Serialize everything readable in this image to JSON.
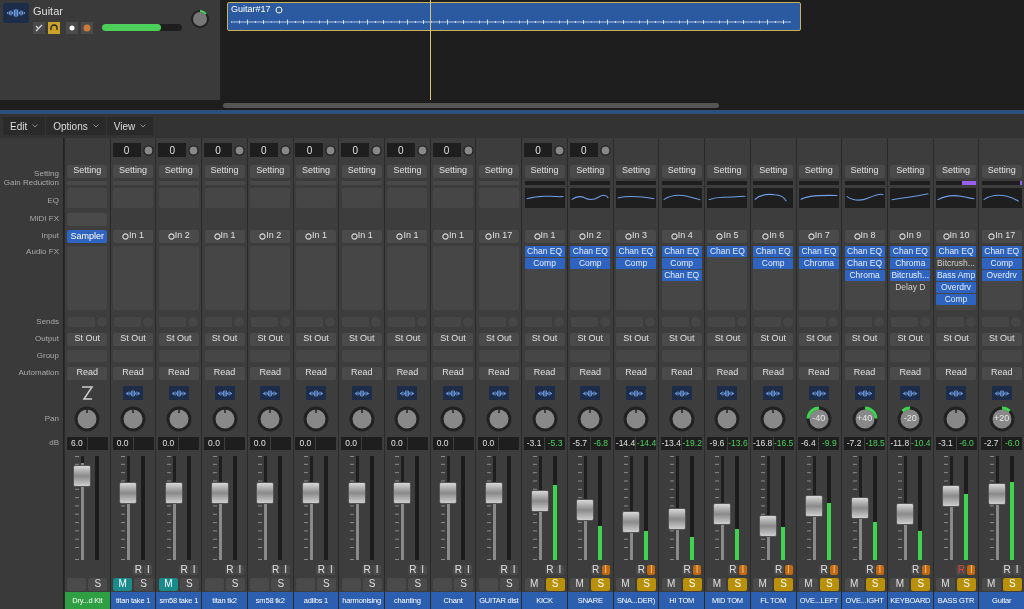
{
  "track": {
    "name": "Guitar",
    "headphones_on": true,
    "volume": {
      "level": 0.74
    },
    "region": {
      "title": "Guitar#17"
    }
  },
  "menu": [
    "Edit",
    "Options",
    "View"
  ],
  "row_labels": {
    "setting": "Setting",
    "gain_reduction": "Gain Reduction",
    "eq": "EQ",
    "midi_fx": "MIDI FX",
    "input": "Input",
    "audio_fx": "Audio FX",
    "sends": "Sends",
    "output": "Output",
    "group": "Group",
    "automation": "Automation",
    "pan": "Pan",
    "db": "dB"
  },
  "channels": [
    {
      "name": "Dry...d Kit",
      "kind": "instrument",
      "setting": "Setting",
      "input": "Sampler",
      "output": "St Out",
      "automation": "Read",
      "volume": "6.0",
      "fader": {
        "level": 0.93
      },
      "mute": {
        "on": false
      },
      "solo": {
        "label": "S",
        "on": false
      }
    },
    {
      "name": "titan take 1",
      "kind": "audio",
      "gain": "0",
      "setting": "Setting",
      "input": "In 1",
      "output": "St Out",
      "automation": "Read",
      "volume": "0.0",
      "fader": {
        "level": 0.72
      },
      "record": {
        "label": "R",
        "on": false
      },
      "monitor": {
        "label": "I",
        "on": false
      },
      "mute": {
        "label": "M",
        "on": true
      },
      "solo": {
        "label": "S",
        "on": false
      }
    },
    {
      "name": "sm58 take 1",
      "kind": "audio",
      "gain": "0",
      "setting": "Setting",
      "input": "In 2",
      "output": "St Out",
      "automation": "Read",
      "volume": "0.0",
      "fader": {
        "level": 0.72
      },
      "record": {
        "label": "R",
        "on": false
      },
      "monitor": {
        "label": "I",
        "on": false
      },
      "mute": {
        "label": "M",
        "on": true
      },
      "solo": {
        "label": "S",
        "on": false
      }
    },
    {
      "name": "titan tk2",
      "kind": "audio",
      "gain": "0",
      "setting": "Setting",
      "input": "In 1",
      "output": "St Out",
      "automation": "Read",
      "volume": "0.0",
      "fader": {
        "level": 0.72
      },
      "record": {
        "label": "R",
        "on": false
      },
      "monitor": {
        "label": "I",
        "on": false
      },
      "mute": {
        "on": false
      },
      "solo": {
        "label": "S",
        "on": false
      }
    },
    {
      "name": "sm58 tk2",
      "kind": "audio",
      "gain": "0",
      "setting": "Setting",
      "input": "In 2",
      "output": "St Out",
      "automation": "Read",
      "volume": "0.0",
      "fader": {
        "level": 0.72
      },
      "record": {
        "label": "R",
        "on": false
      },
      "monitor": {
        "label": "I",
        "on": false
      },
      "mute": {
        "on": false
      },
      "solo": {
        "label": "S",
        "on": false
      }
    },
    {
      "name": "adlibs 1",
      "kind": "audio",
      "gain": "0",
      "setting": "Setting",
      "input": "In 1",
      "output": "St Out",
      "automation": "Read",
      "volume": "0.0",
      "fader": {
        "level": 0.72
      },
      "record": {
        "label": "R",
        "on": false
      },
      "monitor": {
        "label": "I",
        "on": false
      },
      "mute": {
        "on": false
      },
      "solo": {
        "label": "S",
        "on": false
      }
    },
    {
      "name": "harmonising",
      "kind": "audio",
      "gain": "0",
      "setting": "Setting",
      "input": "In 1",
      "output": "St Out",
      "automation": "Read",
      "volume": "0.0",
      "fader": {
        "level": 0.72
      },
      "record": {
        "label": "R",
        "on": false
      },
      "monitor": {
        "label": "I",
        "on": false
      },
      "mute": {
        "on": false
      },
      "solo": {
        "label": "S",
        "on": false
      }
    },
    {
      "name": "chanting",
      "kind": "audio",
      "gain": "0",
      "setting": "Setting",
      "input": "In 1",
      "output": "St Out",
      "automation": "Read",
      "volume": "0.0",
      "fader": {
        "level": 0.72
      },
      "record": {
        "label": "R",
        "on": false
      },
      "monitor": {
        "label": "I",
        "on": false
      },
      "mute": {
        "on": false
      },
      "solo": {
        "label": "S",
        "on": false
      }
    },
    {
      "name": "Chant",
      "kind": "audio",
      "gain": "0",
      "setting": "Setting",
      "input": "In 1",
      "output": "St Out",
      "automation": "Read",
      "volume": "0.0",
      "fader": {
        "level": 0.72
      },
      "record": {
        "label": "R",
        "on": false
      },
      "monitor": {
        "label": "I",
        "on": false
      },
      "mute": {
        "on": false
      },
      "solo": {
        "label": "S",
        "on": false
      }
    },
    {
      "name": "GUITAR dist",
      "kind": "audio",
      "setting": "Setting",
      "input": "In 17",
      "output": "St Out",
      "automation": "Read",
      "volume": "0.0",
      "fader": {
        "level": 0.72
      },
      "record": {
        "label": "R",
        "on": false
      },
      "monitor": {
        "label": "I",
        "on": false
      },
      "mute": {
        "on": false
      },
      "solo": {
        "label": "S",
        "on": false
      }
    },
    {
      "name": "KICK",
      "kind": "audio",
      "gain": "0",
      "setting": "Setting",
      "eq": true,
      "input": "In 1",
      "audio_fx": [
        {
          "name": "Chan EQ",
          "active": true
        },
        {
          "name": "Comp",
          "active": true
        }
      ],
      "output": "St Out",
      "automation": "Read",
      "volume": "-3.1",
      "peak": "-5.3",
      "fader": {
        "level": 0.62
      },
      "meter": {
        "level": 0.72
      },
      "record": {
        "label": "R",
        "on": false
      },
      "monitor": {
        "label": "I",
        "on": false
      },
      "mute": {
        "label": "M",
        "on": false
      },
      "solo": {
        "label": "S",
        "on": true
      }
    },
    {
      "name": "SNARE",
      "kind": "audio",
      "gain": "0",
      "setting": "Setting",
      "eq": true,
      "input": "In 2",
      "audio_fx": [
        {
          "name": "Chan EQ",
          "active": true
        },
        {
          "name": "Comp",
          "active": true
        }
      ],
      "output": "St Out",
      "automation": "Read",
      "volume": "-5.7",
      "peak": "-6.8",
      "fader": {
        "level": 0.5
      },
      "meter": {
        "level": 0.33
      },
      "record": {
        "label": "R",
        "on": false
      },
      "monitor": {
        "label": "I",
        "on": true
      },
      "mute": {
        "label": "M",
        "on": false
      },
      "solo": {
        "label": "S",
        "on": true
      }
    },
    {
      "name": "SNA...DER)",
      "kind": "audio",
      "setting": "Setting",
      "eq": true,
      "input": "In 3",
      "audio_fx": [
        {
          "name": "Chan EQ",
          "active": true
        },
        {
          "name": "Comp",
          "active": true
        }
      ],
      "output": "St Out",
      "automation": "Read",
      "volume": "-14.4",
      "peak": "-14.4",
      "fader": {
        "level": 0.35
      },
      "meter": {
        "level": 0.28
      },
      "record": {
        "label": "R",
        "on": false
      },
      "monitor": {
        "label": "I",
        "on": true
      },
      "mute": {
        "label": "M",
        "on": false
      },
      "solo": {
        "label": "S",
        "on": true
      }
    },
    {
      "name": "HI TOM",
      "kind": "audio",
      "setting": "Setting",
      "eq": true,
      "input": "In 4",
      "audio_fx": [
        {
          "name": "Chan EQ",
          "active": true
        },
        {
          "name": "Comp",
          "active": true
        },
        {
          "name": "Chan EQ",
          "active": true
        }
      ],
      "output": "St Out",
      "automation": "Read",
      "volume": "-13.4",
      "peak": "-19.2",
      "fader": {
        "level": 0.38
      },
      "meter": {
        "level": 0.22
      },
      "record": {
        "label": "R",
        "on": false
      },
      "monitor": {
        "label": "I",
        "on": true
      },
      "mute": {
        "label": "M",
        "on": false
      },
      "solo": {
        "label": "S",
        "on": true
      }
    },
    {
      "name": "MID TOM",
      "kind": "audio",
      "setting": "Setting",
      "eq": true,
      "input": "In 5",
      "audio_fx": [
        {
          "name": "Chan EQ",
          "active": true
        }
      ],
      "output": "St Out",
      "automation": "Read",
      "volume": "-9.6",
      "peak": "-13.6",
      "fader": {
        "level": 0.45
      },
      "meter": {
        "level": 0.3
      },
      "record": {
        "label": "R",
        "on": false
      },
      "monitor": {
        "label": "I",
        "on": true
      },
      "mute": {
        "label": "M",
        "on": false
      },
      "solo": {
        "label": "S",
        "on": true
      }
    },
    {
      "name": "FL TOM",
      "kind": "audio",
      "setting": "Setting",
      "eq": true,
      "input": "In 6",
      "audio_fx": [
        {
          "name": "Chan EQ",
          "active": true
        },
        {
          "name": "Comp",
          "active": true
        }
      ],
      "output": "St Out",
      "automation": "Read",
      "volume": "-16.8",
      "peak": "-16.5",
      "fader": {
        "level": 0.3
      },
      "meter": {
        "level": 0.32
      },
      "record": {
        "label": "R",
        "on": false
      },
      "monitor": {
        "label": "I",
        "on": true
      },
      "mute": {
        "label": "M",
        "on": false
      },
      "solo": {
        "label": "S",
        "on": true
      }
    },
    {
      "name": "OVE...LEFT",
      "kind": "audio",
      "setting": "Setting",
      "eq": true,
      "input": "In 7",
      "audio_fx": [
        {
          "name": "Chan EQ",
          "active": true
        },
        {
          "name": "Chroma",
          "active": true
        }
      ],
      "output": "St Out",
      "automation": "Read",
      "pan": "-40",
      "volume": "-6.4",
      "peak": "-9.9",
      "fader": {
        "level": 0.55
      },
      "meter": {
        "level": 0.55
      },
      "record": {
        "label": "R",
        "on": false
      },
      "monitor": {
        "label": "I",
        "on": true
      },
      "mute": {
        "label": "M",
        "on": false
      },
      "solo": {
        "label": "S",
        "on": true
      }
    },
    {
      "name": "OVE...IGHT",
      "kind": "audio",
      "setting": "Setting",
      "eq": true,
      "input": "In 8",
      "audio_fx": [
        {
          "name": "Chan EQ",
          "active": true
        },
        {
          "name": "Chan EQ",
          "active": true
        },
        {
          "name": "Chroma",
          "active": true
        }
      ],
      "output": "St Out",
      "automation": "Read",
      "pan": "+40",
      "volume": "-7.2",
      "peak": "-18.5",
      "fader": {
        "level": 0.53
      },
      "meter": {
        "level": 0.37
      },
      "record": {
        "label": "R",
        "on": false
      },
      "monitor": {
        "label": "I",
        "on": true
      },
      "mute": {
        "label": "M",
        "on": false
      },
      "solo": {
        "label": "S",
        "on": true
      }
    },
    {
      "name": "KEYBOARD",
      "kind": "audio",
      "setting": "Setting",
      "eq": true,
      "input": "In 9",
      "audio_fx": [
        {
          "name": "Chan EQ",
          "active": true
        },
        {
          "name": "Chroma",
          "active": true
        },
        {
          "name": "Bitcrush...",
          "active": true
        },
        {
          "name": "Delay D",
          "active": false
        }
      ],
      "output": "St Out",
      "automation": "Read",
      "pan": "-20",
      "volume": "-11.8",
      "peak": "-10.4",
      "fader": {
        "level": 0.45
      },
      "meter": {
        "level": 0.28
      },
      "record": {
        "label": "R",
        "on": false
      },
      "monitor": {
        "label": "I",
        "on": true
      },
      "mute": {
        "label": "M",
        "on": false
      },
      "solo": {
        "label": "S",
        "on": true
      }
    },
    {
      "name": "BASS GTR",
      "kind": "audio",
      "setting": "Setting",
      "eq": true,
      "gain_reduction": {
        "level": 0.35
      },
      "input": "In 10",
      "audio_fx": [
        {
          "name": "Chan EQ",
          "active": true
        },
        {
          "name": "Bitcrush...",
          "active": false
        },
        {
          "name": "Bass Amp",
          "active": true
        },
        {
          "name": "Overdrv",
          "active": true
        },
        {
          "name": "Comp",
          "active": true
        }
      ],
      "output": "St Out",
      "automation": "Read",
      "volume": "-3.1",
      "peak": "-6.0",
      "fader": {
        "level": 0.68
      },
      "meter": {
        "level": 0.63
      },
      "record": {
        "label": "R",
        "on": true
      },
      "monitor": {
        "label": "I",
        "on": true
      },
      "mute": {
        "label": "M",
        "on": false
      },
      "solo": {
        "label": "S",
        "on": true
      }
    },
    {
      "name": "Guitar",
      "kind": "audio",
      "setting": "Setting",
      "eq": true,
      "gain_reduction": {
        "level": 0.05
      },
      "input": "In 17",
      "audio_fx": [
        {
          "name": "Chan EQ",
          "active": true
        },
        {
          "name": "Comp",
          "active": true
        },
        {
          "name": "Overdrv",
          "active": true
        }
      ],
      "output": "St Out",
      "automation": "Read",
      "pan": "+20",
      "volume": "-2.7",
      "peak": "-6.0",
      "fader": {
        "level": 0.7
      },
      "meter": {
        "level": 0.75
      },
      "record": {
        "label": "R",
        "on": false
      },
      "monitor": {
        "label": "I",
        "on": false
      },
      "mute": {
        "label": "M",
        "on": false
      },
      "solo": {
        "label": "S",
        "on": true
      }
    }
  ]
}
